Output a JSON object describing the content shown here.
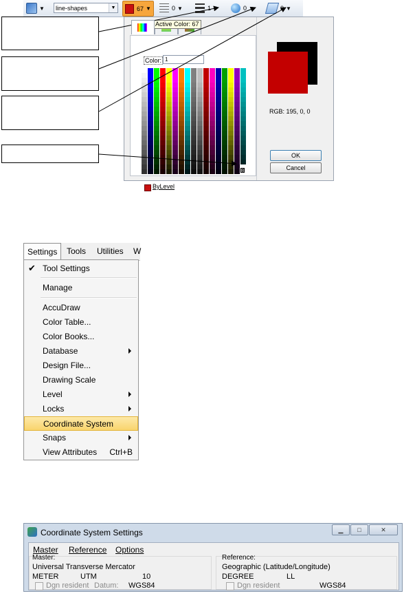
{
  "toolbar": {
    "level_combo_value": "line-shapes",
    "color_value": "67",
    "style_value": "0",
    "weight_value": "1",
    "transparency_value": "0",
    "priority_value": "0"
  },
  "color_dialog": {
    "tooltip": "Active Color: 67",
    "color_label": "Color:",
    "color_value": "1",
    "bylevel_label": "ByLevel",
    "rgb_text": "RGB: 195, 0, 0",
    "ok_label": "OK",
    "cancel_label": "Cancel",
    "grid_last_cell_label": "B",
    "grid_columns": [
      "#ffffff",
      "#0000ff",
      "#00ff00",
      "#ff0000",
      "#ffff00",
      "#ff00ff",
      "#ff7f00",
      "#00ffff",
      "#808080",
      "#ffffff",
      "#0000ff",
      "#00ff00",
      "#ff0000",
      "#ffff00",
      "#ff00ff",
      "#ff7f00",
      "#00ffff"
    ],
    "first_row": [
      "#ffffff",
      "#0000ff",
      "#00ff00",
      "#ff0000",
      "#ffff00",
      "#ff00ff",
      "#ff7f00",
      "#00ffff",
      "#808080",
      "#c0c0c0",
      "#c00000",
      "#ff00c0",
      "#0000b0",
      "#00a000",
      "#ffff00",
      "#9000c0",
      "#00c0c0"
    ],
    "selected_color": "#c30000"
  },
  "menubar": {
    "items": [
      "Settings",
      "Tools",
      "Utilities",
      "W"
    ]
  },
  "settings_menu": {
    "items": [
      {
        "label": "Tool Settings",
        "checked": true
      },
      {
        "label": "Manage"
      },
      {
        "label": "AccuDraw"
      },
      {
        "label": "Color Table..."
      },
      {
        "label": "Color Books..."
      },
      {
        "label": "Database",
        "submenu": true
      },
      {
        "label": "Design File..."
      },
      {
        "label": "Drawing Scale"
      },
      {
        "label": "Level",
        "submenu": true
      },
      {
        "label": "Locks",
        "submenu": true
      },
      {
        "label": "Coordinate System",
        "highlighted": true
      },
      {
        "label": "Snaps",
        "submenu": true
      },
      {
        "label": "View Attributes",
        "shortcut": "Ctrl+B"
      }
    ]
  },
  "coord_window": {
    "title": "Coordinate System Settings",
    "menu": [
      "Master",
      "Reference",
      "Options"
    ],
    "master": {
      "heading": "Master:",
      "system": "Universal Transverse Mercator",
      "unit": "METER",
      "projection": "UTM",
      "zone": "10",
      "dgn_resident": "Dgn resident",
      "datum_label": "Datum:",
      "datum": "WGS84"
    },
    "reference": {
      "heading": "Reference:",
      "system": "Geographic (Latitude/Longitude)",
      "unit": "DEGREE",
      "projection": "LL",
      "dgn_resident": "Dgn resident",
      "datum": "WGS84"
    }
  },
  "colors": {
    "accent_orange": "#f7a63c",
    "menu_highlight": "#f9d46d",
    "window_frame": "#cfdbe9"
  }
}
